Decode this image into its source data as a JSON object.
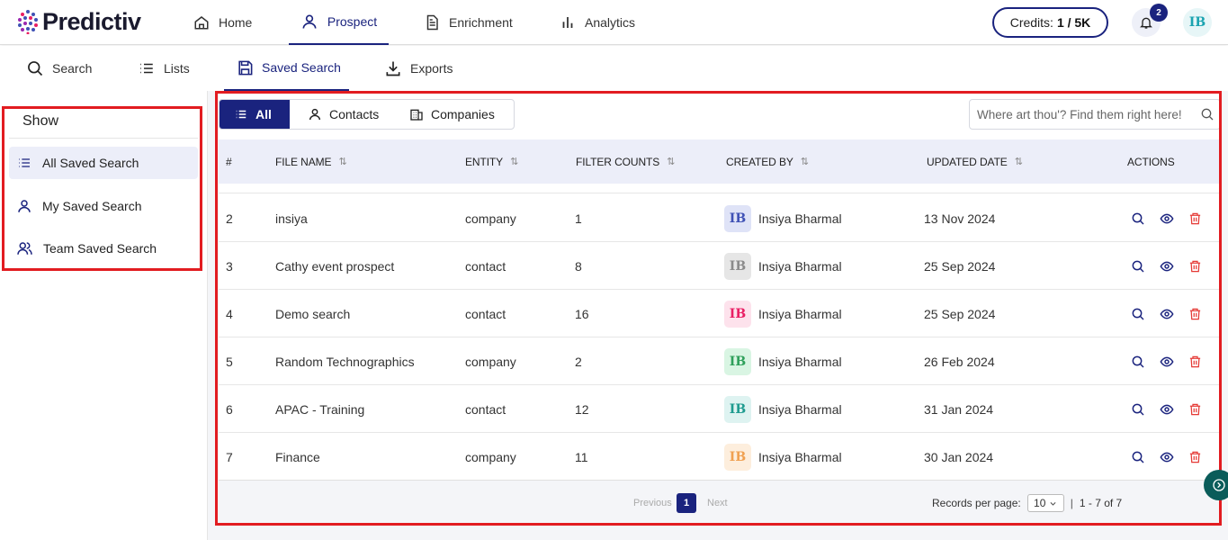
{
  "brand": {
    "name": "Predictiv"
  },
  "topnav": [
    {
      "label": "Home",
      "icon": "home-icon"
    },
    {
      "label": "Prospect",
      "icon": "user-icon",
      "active": true
    },
    {
      "label": "Enrichment",
      "icon": "document-icon"
    },
    {
      "label": "Analytics",
      "icon": "bar-chart-icon"
    }
  ],
  "credits": {
    "label": "Credits:",
    "value": "1 / 5K"
  },
  "notifications": {
    "count": "2"
  },
  "user": {
    "initials": "IB"
  },
  "subnav": [
    {
      "label": "Search",
      "icon": "search-icon"
    },
    {
      "label": "Lists",
      "icon": "list-icon"
    },
    {
      "label": "Saved Search",
      "icon": "save-icon",
      "active": true
    },
    {
      "label": "Exports",
      "icon": "download-icon"
    }
  ],
  "sidebar": {
    "title": "Show",
    "items": [
      {
        "label": "All Saved Search",
        "icon": "list-icon",
        "active": true
      },
      {
        "label": "My Saved Search",
        "icon": "user-icon"
      },
      {
        "label": "Team Saved Search",
        "icon": "users-icon"
      }
    ]
  },
  "entity_toggle": {
    "all": "All",
    "contacts": "Contacts",
    "companies": "Companies"
  },
  "search": {
    "placeholder": "Where art thou'? Find them right here!"
  },
  "table": {
    "columns": {
      "num": "#",
      "file_name": "FILE NAME",
      "entity": "ENTITY",
      "filter_counts": "FILTER COUNTS",
      "created_by": "CREATED BY",
      "updated_date": "UPDATED DATE",
      "actions": "ACTIONS"
    },
    "rows": [
      {
        "num": "2",
        "file_name": "insiya",
        "entity": "company",
        "filter_counts": "1",
        "creator": "Insiya Bharmal",
        "initials": "IB",
        "updated": "13 Nov 2024",
        "avatar_bg": "#dfe3f7",
        "avatar_fg": "#3f51b5"
      },
      {
        "num": "3",
        "file_name": "Cathy event prospect",
        "entity": "contact",
        "filter_counts": "8",
        "creator": "Insiya Bharmal",
        "initials": "IB",
        "updated": "25 Sep 2024",
        "avatar_bg": "#e6e6e6",
        "avatar_fg": "#8a8a8a"
      },
      {
        "num": "4",
        "file_name": "Demo search",
        "entity": "contact",
        "filter_counts": "16",
        "creator": "Insiya Bharmal",
        "initials": "IB",
        "updated": "25 Sep 2024",
        "avatar_bg": "#fde2ec",
        "avatar_fg": "#e91e63"
      },
      {
        "num": "5",
        "file_name": "Random Technographics",
        "entity": "company",
        "filter_counts": "2",
        "creator": "Insiya Bharmal",
        "initials": "IB",
        "updated": "26 Feb 2024",
        "avatar_bg": "#d9f5e3",
        "avatar_fg": "#2ea05a"
      },
      {
        "num": "6",
        "file_name": "APAC - Training",
        "entity": "contact",
        "filter_counts": "12",
        "creator": "Insiya Bharmal",
        "initials": "IB",
        "updated": "31 Jan 2024",
        "avatar_bg": "#def3f1",
        "avatar_fg": "#1e9b8f"
      },
      {
        "num": "7",
        "file_name": "Finance",
        "entity": "company",
        "filter_counts": "11",
        "creator": "Insiya Bharmal",
        "initials": "IB",
        "updated": "30 Jan 2024",
        "avatar_bg": "#fdeedd",
        "avatar_fg": "#f0a050"
      }
    ]
  },
  "pagination": {
    "previous": "Previous",
    "current": "1",
    "next": "Next",
    "records_label": "Records per page:",
    "per_page": "10",
    "range": "1 - 7 of 7"
  },
  "colors": {
    "primary": "#1a237e",
    "danger": "#e53935",
    "highlight": "#e21c21"
  }
}
